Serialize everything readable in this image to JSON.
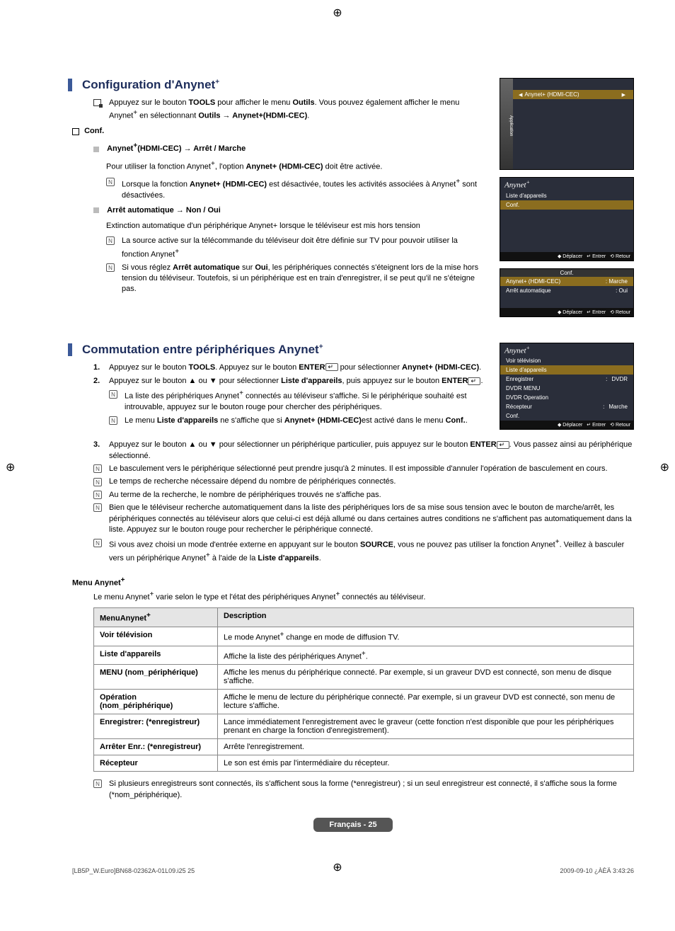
{
  "section1": {
    "title": "Configuration d'Anynet",
    "sup": "+",
    "intro_a": "Appuyez sur le bouton ",
    "intro_b_bold": "TOOLS",
    "intro_c": " pour afficher le menu ",
    "intro_d_bold": "Outils",
    "intro_e": ". Vous pouvez également afficher le menu Anynet",
    "intro_f": " en sélectionnant ",
    "intro_g_bold": "Outils → Anynet+(HDMI-CEC)",
    "intro_h": ".",
    "conf_label": "Conf.",
    "item1_a": "Anynet",
    "item1_b": "(HDMI-CEC) → Arrêt / Marche",
    "item1_body_a": "Pour utiliser la fonction Anynet",
    "item1_body_b": ", l'option ",
    "item1_body_c_bold": "Anynet+ (HDMI-CEC)",
    "item1_body_d": " doit être activée.",
    "item1_note_a": "Lorsque la fonction ",
    "item1_note_b_bold": "Anynet+ (HDMI-CEC)",
    "item1_note_c": " est désactivée, toutes les activités associées à Anynet",
    "item1_note_d": " sont désactivées.",
    "item2_title": "Arrêt automatique → Non / Oui",
    "item2_body": "Extinction automatique d'un périphérique Anynet+ lorsque le téléviseur est mis hors tension",
    "item2_note1_a": "La source active sur la télécommande du téléviseur doit être définie sur TV pour pouvoir utiliser la fonction Anynet",
    "item2_note2_a": "Si vous réglez ",
    "item2_note2_b_bold": "Arrêt automatique",
    "item2_note2_c": " sur ",
    "item2_note2_d_bold": "Oui",
    "item2_note2_e": ", les périphériques connectés s'éteignent lors de la mise hors tension du téléviseur. Toutefois, si un périphérique est en train d'enregistrer, il se peut qu'il ne s'éteigne pas."
  },
  "osd1": {
    "side_label": "Application",
    "row": "Anynet+ (HDMI-CEC)"
  },
  "osd2": {
    "brand": "Anynet",
    "row1": "Liste d'appareils",
    "row2": "Conf.",
    "f_move": "Déplacer",
    "f_enter": "Entrer",
    "f_return": "Retour"
  },
  "osd3": {
    "title": "Conf.",
    "r1_l": "Anynet+ (HDMI-CEC)",
    "r1_v": ": Marche",
    "r2_l": "Arrêt automatique",
    "r2_v": ": Oui",
    "f_move": "Déplacer",
    "f_enter": "Entrer",
    "f_return": "Retour"
  },
  "section2": {
    "title": "Commutation entre périphériques Anynet",
    "sup": "+",
    "step1_a": "Appuyez sur le bouton ",
    "step1_b_bold": "TOOLS",
    "step1_c": ". Appuyez sur le bouton ",
    "step1_d_bold": "ENTER",
    "step1_e": " pour sélectionner ",
    "step1_f_bold": "Anynet+ (HDMI-CEC)",
    "step1_g": ".",
    "step2_a": "Appuyez sur le bouton ▲ ou ▼ pour sélectionner ",
    "step2_b_bold": "Liste d'appareils",
    "step2_c": ", puis appuyez sur le bouton ",
    "step2_d_bold": "ENTER",
    "step2_e": ".",
    "step2_n1_a": "La liste des périphériques Anynet",
    "step2_n1_b": " connectés au téléviseur s'affiche. Si le périphérique souhaité est introuvable, appuyez sur le bouton rouge pour chercher des périphériques.",
    "step2_n2_a": "Le menu ",
    "step2_n2_b_bold": "Liste d'appareils",
    "step2_n2_c": " ne s'affiche que si ",
    "step2_n2_d_bold": "Anynet+ (HDMI-CEC)",
    "step2_n2_e": "est activé dans le menu ",
    "step2_n2_f_bold": "Conf.",
    "step2_n2_g": ".",
    "step3_a": "Appuyez sur le bouton ▲ ou ▼ pour sélectionner un périphérique particulier, puis appuyez sur le bouton ",
    "step3_b_bold": "ENTER",
    "step3_c": ". Vous passez ainsi au périphérique sélectionné.",
    "bn1": "Le basculement vers le périphérique sélectionné peut prendre jusqu'à 2 minutes. Il est impossible d'annuler l'opération de basculement en cours.",
    "bn2": "Le temps de recherche nécessaire dépend du nombre de périphériques connectés.",
    "bn3": "Au terme de la recherche, le nombre de périphériques trouvés ne s'affiche pas.",
    "bn4": "Bien que le téléviseur recherche automatiquement dans la liste des périphériques lors de sa mise sous tension avec le bouton de marche/arrêt, les périphériques connectés au téléviseur alors que celui-ci est déjà allumé ou dans certaines autres conditions ne s'affichent pas automatiquement dans la liste. Appuyez sur le bouton rouge pour rechercher le périphérique connecté.",
    "bn5_a": "Si vous avez choisi un mode d'entrée externe en appuyant sur le bouton ",
    "bn5_b_bold": "SOURCE",
    "bn5_c": ", vous ne pouvez pas utiliser la fonction Anynet",
    "bn5_d": ". Veillez à basculer vers un périphérique Anynet",
    "bn5_e": " à l'aide de la ",
    "bn5_f_bold": "Liste d'appareils",
    "bn5_g": "."
  },
  "osd4": {
    "brand": "Anynet",
    "r1": "Voir télévision",
    "r2": "Liste d'appareils",
    "r3": "Enregistrer",
    "r3v": "DVDR",
    "r4": "DVDR MENU",
    "r5": "DVDR Operation",
    "r6": "Récepteur",
    "r6v": "Marche",
    "r7": "Conf.",
    "f_move": "Déplacer",
    "f_enter": "Entrer",
    "f_return": "Retour"
  },
  "menu_section": {
    "heading": "Menu Anynet",
    "sup": "+",
    "intro_a": "Le menu Anynet",
    "intro_b": " varie selon le type et l'état des périphériques Anynet",
    "intro_c": " connectés au téléviseur.",
    "th1": "MenuAnynet",
    "th2": "Description",
    "rows": [
      {
        "name": "Voir télévision",
        "desc": "Le mode Anynet+ change en mode de diffusion TV."
      },
      {
        "name": "Liste d'appareils",
        "desc": "Affiche la liste des périphériques Anynet+."
      },
      {
        "name_bold": "MENU",
        "name_rest": " (nom_périphérique)",
        "desc": "Affiche les menus du périphérique connecté. Par exemple, si un graveur DVD est connecté, son menu de disque s'affiche."
      },
      {
        "name_bold": "Opération",
        "name_rest": " (nom_périphérique)",
        "desc": "Affiche le menu de lecture du périphérique connecté. Par exemple, si un graveur DVD est connecté, son menu de lecture s'affiche."
      },
      {
        "name_bold": "Enregistrer",
        "name_rest": ": (*enregistreur)",
        "desc": "Lance immédiatement l'enregistrement avec le graveur (cette fonction n'est disponible que pour les périphériques prenant en charge la fonction d'enregistrement)."
      },
      {
        "name_bold": "Arrêter Enr.",
        "name_rest": ": (*enregistreur)",
        "desc": "Arrête l'enregistrement."
      },
      {
        "name": "Récepteur",
        "desc": "Le son est émis par l'intermédiaire du récepteur."
      }
    ],
    "footnote": "Si plusieurs enregistreurs sont connectés, ils s'affichent sous la forme (*enregistreur) ; si un seul enregistreur est connecté, il s'affiche sous la forme (*nom_périphérique)."
  },
  "page_footer": "Français - 25",
  "print_footer_left": "[LB5P_W.Euro]BN68-02362A-01L09.i25   25",
  "print_footer_right": "2009-09-10   ¿ÀÈÄ 3:43:26"
}
